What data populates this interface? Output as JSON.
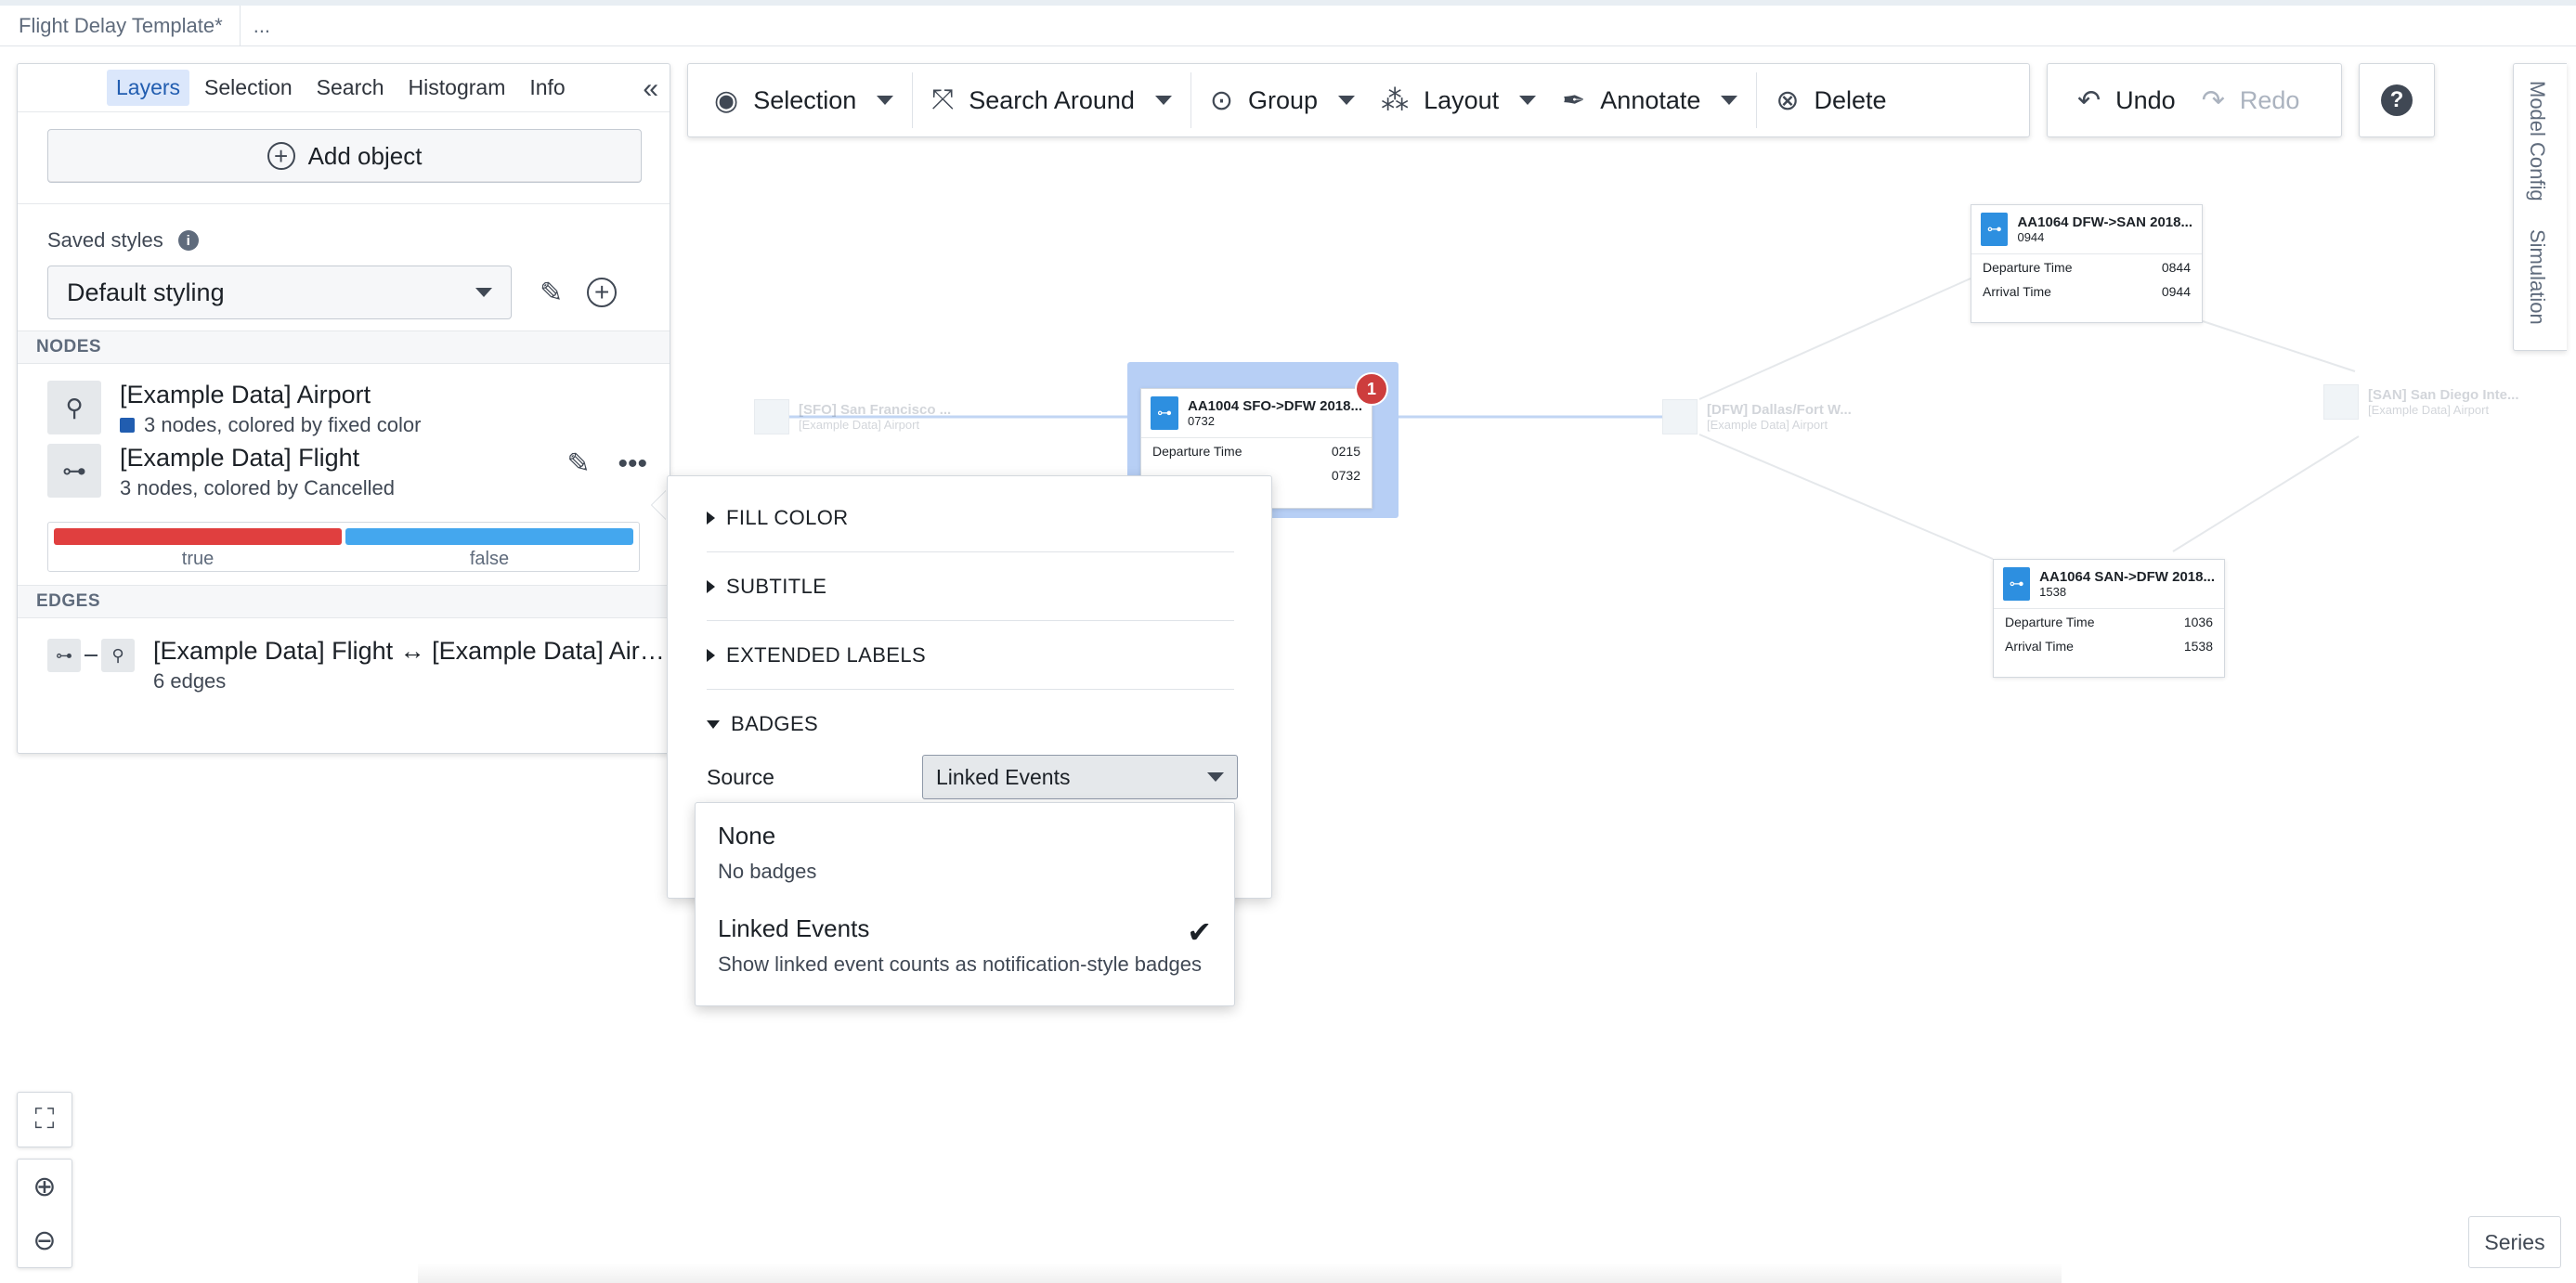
{
  "document": {
    "title": "Flight Delay Template*",
    "more": "..."
  },
  "left_panel": {
    "tabs": [
      {
        "label": "Layers",
        "active": true
      },
      {
        "label": "Selection",
        "active": false
      },
      {
        "label": "Search",
        "active": false
      },
      {
        "label": "Histogram",
        "active": false
      },
      {
        "label": "Info",
        "active": false
      }
    ],
    "add_object_label": "Add object",
    "saved_styles_label": "Saved styles",
    "saved_style_value": "Default styling",
    "nodes_header": "NODES",
    "nodes": [
      {
        "title": "[Example Data] Airport",
        "subtitle": "3 nodes, colored by fixed color"
      },
      {
        "title": "[Example Data] Flight",
        "subtitle": "3 nodes, colored by Cancelled"
      }
    ],
    "legend": [
      {
        "label": "true",
        "color": "#e03f3f"
      },
      {
        "label": "false",
        "color": "#44a7ee"
      }
    ],
    "edges_header": "EDGES",
    "edge": {
      "title": "[Example Data] Flight ↔ [Example Data] Air…",
      "subtitle": "6 edges"
    }
  },
  "toolbar": {
    "selection": "Selection",
    "search_around": "Search Around",
    "group": "Group",
    "layout": "Layout",
    "annotate": "Annotate",
    "delete": "Delete",
    "undo": "Undo",
    "redo": "Redo",
    "help": "?"
  },
  "right_tabs": {
    "model_config": "Model Config",
    "simulation": "Simulation"
  },
  "graph": {
    "airports": [
      {
        "name": "[SFO] San Francisco ...",
        "type": "[Example Data] Airport"
      },
      {
        "name": "[DFW] Dallas/Fort W...",
        "type": "[Example Data] Airport"
      },
      {
        "name": "[SAN] San Diego Inte...",
        "type": "[Example Data] Airport"
      }
    ],
    "flights": [
      {
        "title": "AA1004 SFO->DFW 2018...",
        "subtitle": "0732",
        "rows": [
          {
            "label": "Departure Time",
            "value": "0215"
          },
          {
            "label": "",
            "value": "0732"
          }
        ],
        "badge": "1"
      },
      {
        "title": "AA1064 DFW->SAN 2018...",
        "subtitle": "0944",
        "rows": [
          {
            "label": "Departure Time",
            "value": "0844"
          },
          {
            "label": "Arrival Time",
            "value": "0944"
          }
        ]
      },
      {
        "title": "AA1064 SAN->DFW 2018...",
        "subtitle": "1538",
        "rows": [
          {
            "label": "Departure Time",
            "value": "1036"
          },
          {
            "label": "Arrival Time",
            "value": "1538"
          }
        ]
      }
    ]
  },
  "popover": {
    "sections": [
      "FILL COLOR",
      "SUBTITLE",
      "EXTENDED LABELS",
      "BADGES"
    ],
    "source_label": "Source",
    "source_value": "Linked Events"
  },
  "dropdown": {
    "options": [
      {
        "title": "None",
        "description": "No badges",
        "selected": false
      },
      {
        "title": "Linked Events",
        "description": "Show linked event counts as notification-style badges",
        "selected": true
      }
    ]
  },
  "series_label": "Series"
}
